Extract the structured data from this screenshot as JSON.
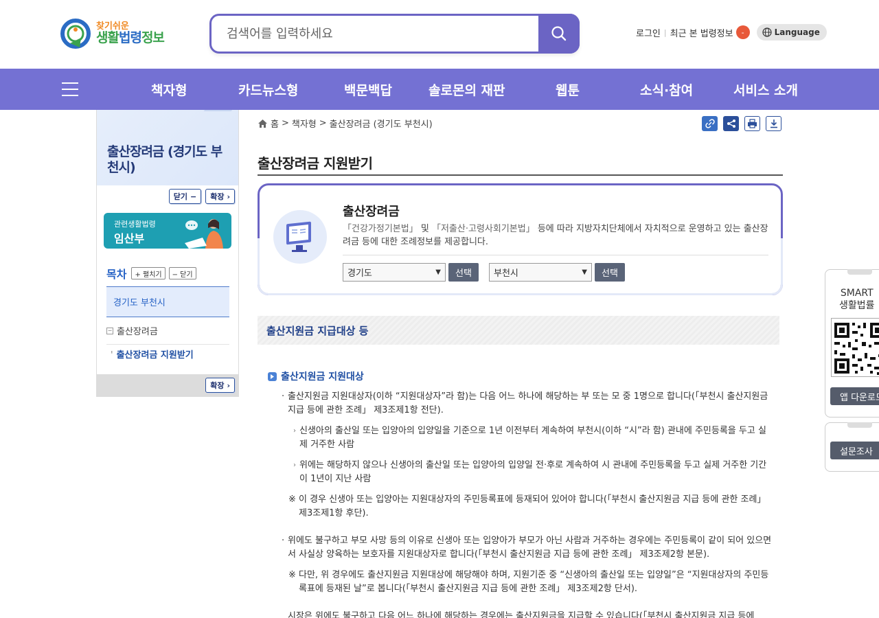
{
  "header": {
    "logo_small": "찾기쉬운",
    "logo_big_1": "생활",
    "logo_big_2": "법령",
    "logo_big_3": "정보",
    "search_placeholder": "검색어를 입력하세요",
    "login": "로그인",
    "recent": "최근 본 법령정보",
    "recent_count": "-",
    "language": "Language"
  },
  "nav": {
    "items": [
      "책자형",
      "카드뉴스형",
      "백문백답",
      "솔로몬의 재판",
      "웹툰",
      "소식·참여",
      "서비스 소개"
    ]
  },
  "sidebar": {
    "title": "출산장려금 (경기도 부천시)",
    "close": "닫기",
    "expand": "확장",
    "related_sub": "관련생활법령",
    "related_main": "임산부",
    "toc_title": "목차",
    "toc_expand": "+ 펼치기",
    "toc_collapse": "− 닫기",
    "toc_city": "경기도 부천시",
    "toc_l1": "출산장려금",
    "toc_l2": "출산장려금 지원받기",
    "foot_expand": "확장"
  },
  "breadcrumb": {
    "home": "홈",
    "sep": ">",
    "c1": "책자형",
    "c2": "출산장려금 (경기도 부천시)"
  },
  "page": {
    "title": "출산장려금 지원받기"
  },
  "intro": {
    "heading": "출산장려금",
    "law1": "「건강가정기본법」",
    "and": " 및 ",
    "law2": "「저출산·고령사회기본법」",
    "desc": " 등에 따라 지방자치단체에서 자치적으로 운영하고 있는 출산장려금 등에 대한 조례정보를 제공합니다.",
    "select1": "경기도",
    "select2": "부천시",
    "select_btn": "선택"
  },
  "section": {
    "title": "출산지원금 지급대상 등",
    "sub_title": "출산지원금 지원대상",
    "p1": "출산지원금 지원대상자(이하 “지원대상자”라 함)는 다음 어느 하나에 해당하는 부 또는 모 중 1명으로 합니다(「부천시 출산지원금 지급 등에 관한 조례」 제3조제1항 전단).",
    "p1a": "신생아의 출산일 또는 입양아의 입양일을 기준으로 1년 이전부터 계속하여 부천시(이하 “시”라 함) 관내에 주민등록을 두고 실제 거주한 사람",
    "p1b": "위에는 해당하지 않으나 신생아의 출산일 또는 입양아의 입양일 전·후로 계속하여 시 관내에 주민등록을 두고 실제 거주한 기간이 1년이 지난 사람",
    "p1note": "이 경우 신생아 또는 입양아는 지원대상자의 주민등록표에 등재되어 있어야 합니다(「부천시 출산지원금 지급 등에 관한 조례」 제3조제1항 후단).",
    "p2": "위에도 불구하고 부모 사망 등의 이유로 신생아 또는 입양아가 부모가 아닌 사람과 거주하는 경우에는 주민등록이 같이 되어 있으면서 사실상 양육하는 보호자를 지원대상자로 합니다(「부천시 출산지원금 지급 등에 관한 조례」 제3조제2항 본문).",
    "p2note": "다만, 위 경우에도 출산지원금 지원대상에 해당해야 하며, 지원기준 중 “신생아의 출산일 또는 입양일”은 “지원대상자의 주민등록표에 등재된 날”로 봅니다(「부천시 출산지원금 지급 등에 관한 조례」 제3조제2항 단서).",
    "p3": "시장은 위에도 불구하고 다음 어느 하나에 해당하는 경우에는 출산지원금을 지급할 수 있습니다(「부천시 출산지원금 지급 등에"
  },
  "floating": {
    "smart_1": "SMART",
    "smart_2": "생활법률",
    "app_download": "앱 다운로드",
    "survey": "설문조사"
  },
  "colors": {
    "brand": "#7471d3",
    "search_border": "#6b64c4",
    "link_blue": "#1f4fa3"
  }
}
